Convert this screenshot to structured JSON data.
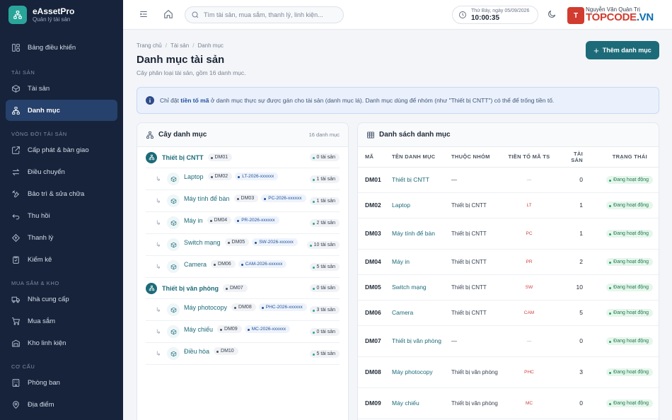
{
  "brand": {
    "name": "eAssetPro",
    "subtitle": "Quản lý tài sản"
  },
  "sidebar": {
    "top_item": {
      "label": "Bảng điều khiển",
      "icon": "dashboard-icon"
    },
    "sections": [
      {
        "title": "TÀI SẢN",
        "items": [
          {
            "label": "Tài sản",
            "icon": "box-icon",
            "active": false
          },
          {
            "label": "Danh mục",
            "icon": "hierarchy-icon",
            "active": true
          }
        ]
      },
      {
        "title": "VÒNG ĐỜI TÀI SẢN",
        "items": [
          {
            "label": "Cấp phát & bàn giao",
            "icon": "handover-icon"
          },
          {
            "label": "Điều chuyển",
            "icon": "transfer-icon"
          },
          {
            "label": "Bảo trì & sửa chữa",
            "icon": "wrench-icon"
          },
          {
            "label": "Thu hồi",
            "icon": "return-icon"
          },
          {
            "label": "Thanh lý",
            "icon": "liquidation-icon"
          },
          {
            "label": "Kiểm kê",
            "icon": "audit-icon"
          }
        ]
      },
      {
        "title": "MUA SẮM & KHO",
        "items": [
          {
            "label": "Nhà cung cấp",
            "icon": "truck-icon"
          },
          {
            "label": "Mua sắm",
            "icon": "cart-icon"
          },
          {
            "label": "Kho linh kiện",
            "icon": "warehouse-icon"
          }
        ]
      },
      {
        "title": "CƠ CẤU",
        "items": [
          {
            "label": "Phòng ban",
            "icon": "building-icon"
          },
          {
            "label": "Địa điểm",
            "icon": "location-icon"
          }
        ]
      }
    ]
  },
  "topbar": {
    "search_placeholder": "Tìm tài sản, mua sắm, thanh lý, linh kiện...",
    "date": "Thứ Bảy, ngày 05/09/2026",
    "time": "10:00:35",
    "user_name": "Nguyễn Văn Quản Trị",
    "logo_text_a": "TOPCODE",
    "logo_text_b": ".VN"
  },
  "page": {
    "breadcrumb": [
      "Trang chủ",
      "Tài sản",
      "Danh mục"
    ],
    "title": "Danh mục tài sản",
    "subtitle": "Cây phân loại tài sản, gồm 16 danh mục.",
    "add_button": "Thêm danh mục",
    "alert_pre": "Chỉ đặt ",
    "alert_bold": "tiền tố mã",
    "alert_post": " ở danh mục thực sự được gán cho tài sản (danh mục lá). Danh mục dùng để nhóm (như \"Thiết bị CNTT\") có thể để trống tiền tố."
  },
  "tree": {
    "title": "Cây danh mục",
    "count": "16 danh mục",
    "groups": [
      {
        "name": "Thiết bị CNTT",
        "code": "DM01",
        "count": "0 tài sản",
        "children": [
          {
            "name": "Laptop",
            "code": "DM02",
            "prefix": "LT-2026-xxxxxx",
            "count": "1 tài sản"
          },
          {
            "name": "Máy tính để bàn",
            "code": "DM03",
            "prefix": "PC-2026-xxxxxx",
            "count": "1 tài sản"
          },
          {
            "name": "Máy in",
            "code": "DM04",
            "prefix": "PR-2026-xxxxxx",
            "count": "2 tài sản"
          },
          {
            "name": "Switch mạng",
            "code": "DM05",
            "prefix": "SW-2026-xxxxxx",
            "count": "10 tài sản"
          },
          {
            "name": "Camera",
            "code": "DM06",
            "prefix": "CAM-2026-xxxxxx",
            "count": "5 tài sản"
          }
        ]
      },
      {
        "name": "Thiết bị văn phòng",
        "code": "DM07",
        "count": "0 tài sản",
        "children": [
          {
            "name": "Máy photocopy",
            "code": "DM08",
            "prefix": "PHC-2026-xxxxxx",
            "count": "3 tài sản"
          },
          {
            "name": "Máy chiếu",
            "code": "DM09",
            "prefix": "MC-2026-xxxxxx",
            "count": "0 tài sản"
          },
          {
            "name": "Điều hòa",
            "code": "DM10",
            "prefix": "",
            "count": "5 tài sản"
          }
        ]
      }
    ]
  },
  "table": {
    "title": "Danh sách danh mục",
    "headers": [
      "MÃ",
      "TÊN DANH MỤC",
      "THUỘC NHÓM",
      "TIỀN TỐ MÃ TS",
      "TÀI SẢN",
      "TRẠNG THÁI"
    ],
    "rows": [
      {
        "code": "DM01",
        "name": "Thiết bị CNTT",
        "group": "—",
        "prefix": "—",
        "assets": "0",
        "status": "Đang hoạt động"
      },
      {
        "code": "DM02",
        "name": "Laptop",
        "group": "Thiết bị CNTT",
        "prefix": "LT",
        "assets": "1",
        "status": "Đang hoạt động"
      },
      {
        "code": "DM03",
        "name": "Máy tính để bàn",
        "group": "Thiết bị CNTT",
        "prefix": "PC",
        "assets": "1",
        "status": "Đang hoạt động"
      },
      {
        "code": "DM04",
        "name": "Máy in",
        "group": "Thiết bị CNTT",
        "prefix": "PR",
        "assets": "2",
        "status": "Đang hoạt động"
      },
      {
        "code": "DM05",
        "name": "Switch mạng",
        "group": "Thiết bị CNTT",
        "prefix": "SW",
        "assets": "10",
        "status": "Đang hoạt động"
      },
      {
        "code": "DM06",
        "name": "Camera",
        "group": "Thiết bị CNTT",
        "prefix": "CAM",
        "assets": "5",
        "status": "Đang hoạt động"
      },
      {
        "code": "DM07",
        "name": "Thiết bị văn phòng",
        "group": "—",
        "prefix": "—",
        "assets": "0",
        "status": "Đang hoạt động"
      },
      {
        "code": "DM08",
        "name": "Máy photocopy",
        "group": "Thiết bị văn phòng",
        "prefix": "PHC",
        "assets": "3",
        "status": "Đang hoạt động"
      },
      {
        "code": "DM09",
        "name": "Máy chiếu",
        "group": "Thiết bị văn phòng",
        "prefix": "MC",
        "assets": "0",
        "status": "Đang hoạt động"
      }
    ]
  }
}
